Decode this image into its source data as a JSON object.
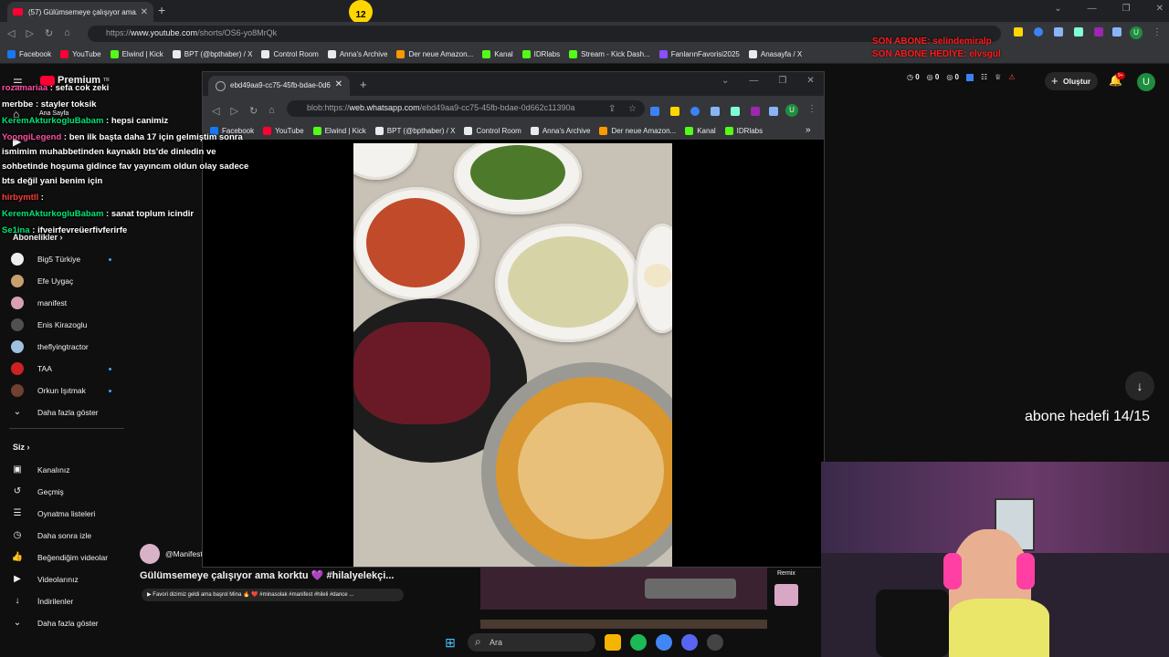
{
  "browser": {
    "tab_title": "(57) Gülümsemeye çalışıyor ama...",
    "url_prefix": "https://",
    "url_domain": "www.youtube.com",
    "url_path": "/shorts/OS6-yo8MrQk",
    "avatar_letter": "U",
    "bookmarks": [
      {
        "label": "Facebook",
        "color": "#1877f2"
      },
      {
        "label": "YouTube",
        "color": "#ff0033"
      },
      {
        "label": "Elwind | Kick",
        "color": "#53fc18"
      },
      {
        "label": "BPT (@bpthaber) / X",
        "color": "#e8eaed"
      },
      {
        "label": "Control Room",
        "color": "#e8eaed"
      },
      {
        "label": "Anna's Archive",
        "color": "#e8eaed"
      },
      {
        "label": "Der neue Amazon...",
        "color": "#ff9900"
      },
      {
        "label": "Kanal",
        "color": "#53fc18"
      },
      {
        "label": "IDRlabs",
        "color": "#53fc18"
      },
      {
        "label": "Stream - Kick Dash...",
        "color": "#53fc18"
      },
      {
        "label": "FanlarınFavorisi2025",
        "color": "#8a4fff"
      },
      {
        "label": "Anasayfa / X",
        "color": "#e8eaed"
      }
    ]
  },
  "youtube": {
    "logo_text": "Premium",
    "logo_sup": "TR",
    "home_label": "Ana Sayfa",
    "subscriptions_title": "Abonelikler",
    "subscriptions": [
      {
        "name": "Big5 Türkiye",
        "color": "#eeeeee",
        "dot": true
      },
      {
        "name": "Efe Uygaç",
        "color": "#c8a070",
        "dot": false
      },
      {
        "name": "manifest",
        "color": "#d8a0b0",
        "dot": false
      },
      {
        "name": "Enis Kirazoglu",
        "color": "#505050",
        "dot": false
      },
      {
        "name": "theflyingtractor",
        "color": "#a0c0e0",
        "dot": false
      },
      {
        "name": "TAA",
        "color": "#cc2222",
        "dot": true
      },
      {
        "name": "Orkun Işıtmak",
        "color": "#704030",
        "dot": true
      }
    ],
    "show_more": "Daha fazla göster",
    "you_title": "Siz",
    "you_items": [
      "Kanalınız",
      "Geçmiş",
      "Oynatma listeleri",
      "Daha sonra izle",
      "Beğendiğim videolar",
      "Videolarınız",
      "İndirilenler",
      "Daha fazla göster"
    ],
    "create_label": "Oluştur",
    "bell_badge": "9+",
    "counters": [
      "0",
      "0",
      "0"
    ],
    "channel": "@Manifest",
    "short_title": "Gülümsemeye çalışıyor ama korktu 💜 #hilalyelekçi...",
    "music": "▶ Favori dizimiz geldi ama başrol Mina 🔥 ❤️ #minasolak #manifest #hileli #dance ...",
    "remix": "Remix"
  },
  "chat": [
    {
      "user": "rozamariaa",
      "text": ": sefa cok zeki",
      "color": "pink"
    },
    {
      "user": "merbbe",
      "text": ": stayler toksik",
      "color": "white"
    },
    {
      "user": "KeremAkturkogluBabam",
      "text": ": hepsi canimiz",
      "color": "green"
    },
    {
      "user": "YoongiLegend",
      "text": ": ben ilk başta daha 17 için gelmiştim sonra ismimim muhabbetinden kaynaklı bts'de dinledin ve sohbetinde hoşuma gidince fav yayıncım oldun olay sadece bts değil yani benim için",
      "color": "pink"
    },
    {
      "user": "hirbymtll",
      "text": ":",
      "color": "red"
    },
    {
      "user": "KeremAkturkogluBabam",
      "text": ": sanat toplum icindir",
      "color": "green"
    },
    {
      "user": "Se1ina",
      "text": ": ifveirfevreüerfivferirfe",
      "color": "green"
    }
  ],
  "overlay": {
    "son_abone_1": "SON ABONE: selindemiralp",
    "son_abone_2": "SON ABONE HEDİYE: elvsgul",
    "goal": "abone hedefi 14/15",
    "emoji_num": "12"
  },
  "popup": {
    "tab_title": "ebd49aa9-cc75-45fb-bdae-0d6",
    "url_scheme": "blob:https://",
    "url_domain": "web.whatsapp.com",
    "url_path": "/ebd49aa9-cc75-45fb-bdae-0d662c11390a",
    "avatar_letter": "U",
    "bookmarks": [
      {
        "label": "Facebook",
        "color": "#1877f2"
      },
      {
        "label": "YouTube",
        "color": "#ff0033"
      },
      {
        "label": "Elwind | Kick",
        "color": "#53fc18"
      },
      {
        "label": "BPT (@bpthaber) / X",
        "color": "#e8eaed"
      },
      {
        "label": "Control Room",
        "color": "#e8eaed"
      },
      {
        "label": "Anna's Archive",
        "color": "#e8eaed"
      },
      {
        "label": "Der neue Amazon...",
        "color": "#ff9900"
      },
      {
        "label": "Kanal",
        "color": "#53fc18"
      },
      {
        "label": "IDRlabs",
        "color": "#53fc18"
      }
    ]
  },
  "taskbar": {
    "search_label": "Ara"
  }
}
